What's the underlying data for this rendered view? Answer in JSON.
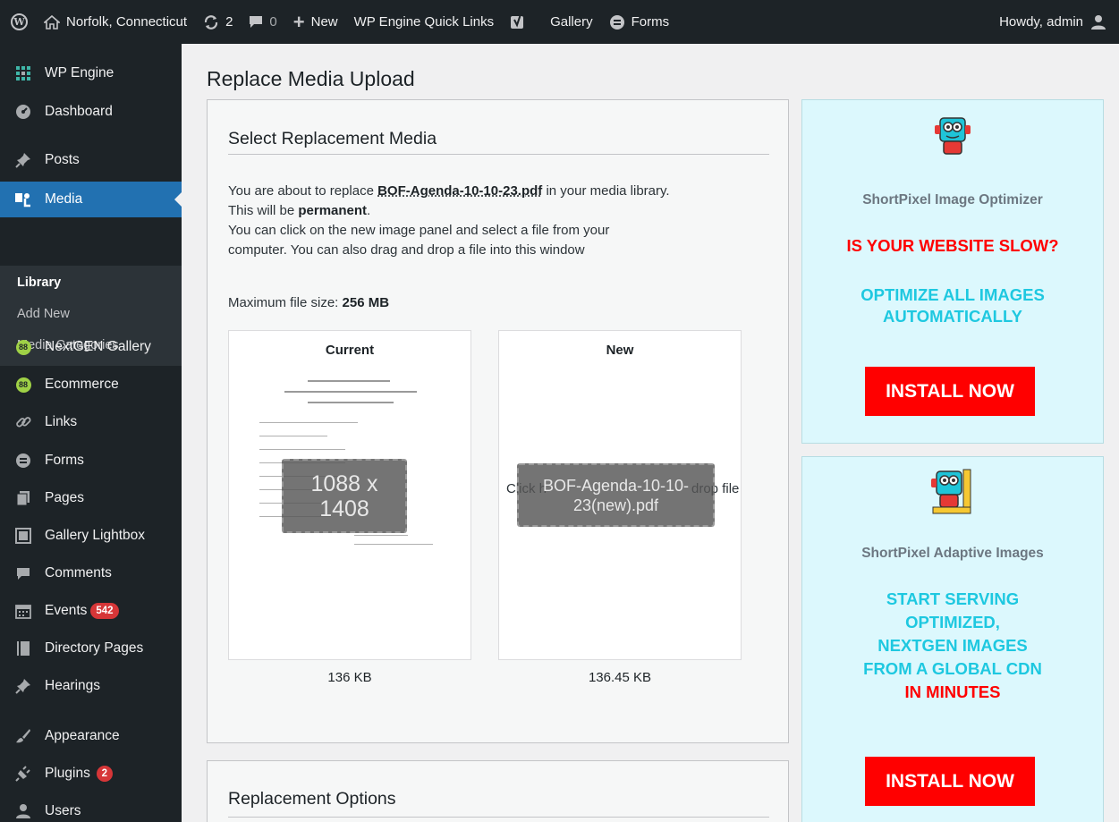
{
  "adminbar": {
    "site_name": "Norfolk, Connecticut",
    "updates_count": "2",
    "comments_count": "0",
    "new_label": "New",
    "quick_links_label": "WP Engine Quick Links",
    "gallery_label": "Gallery",
    "forms_label": "Forms",
    "howdy_label": "Howdy, admin"
  },
  "sidebar": {
    "items": [
      {
        "label": "WP Engine",
        "icon": "wp-engine-icon"
      },
      {
        "label": "Dashboard",
        "icon": "dashboard-icon"
      },
      {
        "label": "Posts",
        "icon": "pin-icon"
      },
      {
        "label": "Media",
        "icon": "media-icon"
      },
      {
        "label": "NextGEN Gallery",
        "icon": "nextgen-icon"
      },
      {
        "label": "Ecommerce",
        "icon": "nextgen-icon"
      },
      {
        "label": "Links",
        "icon": "link-icon"
      },
      {
        "label": "Forms",
        "icon": "forms-icon"
      },
      {
        "label": "Pages",
        "icon": "pages-icon"
      },
      {
        "label": "Gallery Lightbox",
        "icon": "gallery-icon"
      },
      {
        "label": "Comments",
        "icon": "comment-icon"
      },
      {
        "label": "Events",
        "icon": "calendar-icon",
        "badge": "542"
      },
      {
        "label": "Directory Pages",
        "icon": "book-icon"
      },
      {
        "label": "Hearings",
        "icon": "pin-icon"
      },
      {
        "label": "Appearance",
        "icon": "brush-icon"
      },
      {
        "label": "Plugins",
        "icon": "plug-icon",
        "badge": "2"
      },
      {
        "label": "Users",
        "icon": "user-icon"
      }
    ],
    "submenu": [
      "Library",
      "Add New",
      "Media Categories"
    ]
  },
  "main": {
    "page_title": "Replace Media Upload",
    "section_title": "Select Replacement Media",
    "intro_prefix": "You are about to replace ",
    "filename": "BOF-Agenda-10-10-23.pdf",
    "intro_suffix": " in your media library.",
    "this_will_be": "This will be ",
    "permanent": "permanent",
    "period": ".",
    "instructions_line1": "You can click on the new image panel and select a file from your",
    "instructions_line2": "computer. You can also drag and drop a file into this window",
    "max_size_label": "Maximum file size: ",
    "max_size_value": "256 MB",
    "current_label": "Current",
    "new_label": "New",
    "current_dims": "1088 x 1408",
    "new_filename": "BOF-Agenda-10-10-23(new).pdf",
    "new_hint_left": "Click h",
    "new_hint_right": "drop file",
    "current_size": "136 KB",
    "new_size": "136.45 KB",
    "options_title": "Replacement Options"
  },
  "ads": {
    "ad1": {
      "title": "ShortPixel Image Optimizer",
      "line1": "IS YOUR WEBSITE SLOW?",
      "line2a": "OPTIMIZE ALL IMAGES",
      "line2b": "AUTOMATICALLY",
      "button": "INSTALL NOW"
    },
    "ad2": {
      "title": "ShortPixel Adaptive Images",
      "line1": "START SERVING",
      "line2": "OPTIMIZED,",
      "line3": "NEXTGEN IMAGES",
      "line4": "FROM A GLOBAL CDN",
      "line5": "IN MINUTES",
      "button": "INSTALL NOW"
    }
  },
  "colors": {
    "admin_dark": "#1d2327",
    "accent_blue": "#2271b1",
    "ad_bg": "#dcf8fd",
    "ad_red": "#ff0000",
    "ad_cyan": "#1ec8e0",
    "badge_red": "#d63638"
  }
}
